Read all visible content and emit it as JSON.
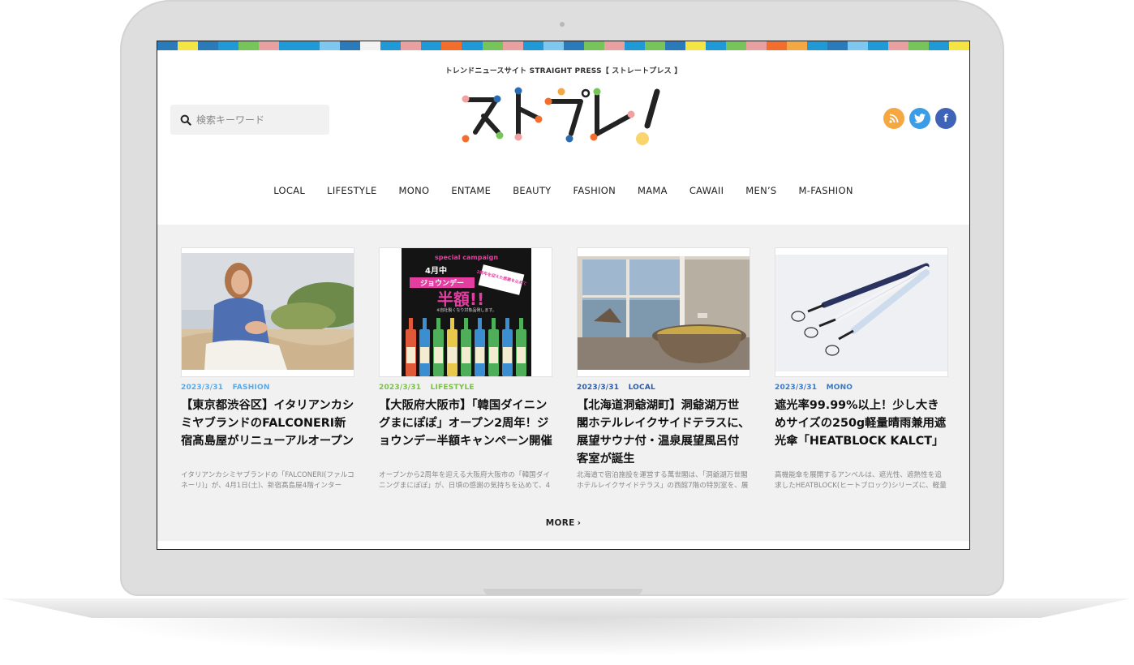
{
  "site": {
    "tagline": "トレンドニュースサイト STRAIGHT PRESS【 ストレートプレス 】",
    "logo_text": "ストプレ!",
    "colorbar": [
      "#2b7bba",
      "#f4e542",
      "#2b7bba",
      "#1f9ad6",
      "#76c45a",
      "#e9a0a0",
      "#1f9ad6",
      "#1f9ad6",
      "#7ec8ef",
      "#2b7bba",
      "#f2f2f2",
      "#1f9ad6",
      "#e9a0a0",
      "#1f9ad6",
      "#f36d2c",
      "#1f9ad6",
      "#76c45a",
      "#e9a0a0",
      "#1f9ad6",
      "#7ec8ef",
      "#2b7bba",
      "#76c45a",
      "#e9a0a0",
      "#1f9ad6",
      "#76c45a",
      "#2b7bba",
      "#f4e542",
      "#1f9ad6",
      "#76c45a",
      "#e9a0a0",
      "#f36d2c",
      "#f4a742",
      "#1f9ad6",
      "#2b7bba",
      "#7ec8ef",
      "#1f9ad6",
      "#e9a0a0",
      "#76c45a",
      "#1f9ad6",
      "#f4e542"
    ]
  },
  "search": {
    "placeholder": "検索キーワード"
  },
  "social": {
    "rss_label": "RSS",
    "twitter_label": "t",
    "facebook_label": "f"
  },
  "nav": {
    "items": [
      "LOCAL",
      "LIFESTYLE",
      "MONO",
      "ENTAME",
      "BEAUTY",
      "FASHION",
      "MAMA",
      "CAWAII",
      "MEN’S",
      "M-FASHION"
    ]
  },
  "articles": [
    {
      "date": "2023/3/31",
      "category": "FASHION",
      "category_color": "#5aa9e6",
      "title": "【東京都渋谷区】イタリアンカシミヤブランドのFALCONERI新宿髙島屋がリニューアルオープン",
      "excerpt": "イタリアンカシミヤブランドの「FALCONERI(ファルコネーリ)」が、4月1日(土)、新宿髙島屋4階インター"
    },
    {
      "date": "2023/3/31",
      "category": "LIFESTYLE",
      "category_color": "#7cbf4a",
      "title": "【大阪府大阪市】「韓国ダイニングまにぽぽ」オープン2周年！ジョウンデー半額キャンペーン開催",
      "excerpt": "オープンから2周年を迎える大阪府大阪市の「韓国ダイニングまにぽぽ」が、日頃の感謝の気持ちを込めて、4",
      "image_text": {
        "campaign": "special campaign",
        "month": "4月中",
        "event": "ジョウンデー",
        "half": "半額!!",
        "badge": "2周年を迎えた感謝を込めて",
        "note": "※自社製くなり対象品例します。"
      }
    },
    {
      "date": "2023/3/31",
      "category": "LOCAL",
      "category_color": "#2a5aa8",
      "title": "【北海道洞爺湖町】洞爺湖万世閣ホテルレイクサイドテラスに、展望サウナ付・温泉展望風呂付客室が誕生",
      "excerpt": "北海道で宿泊施設を運営する萬世閣は、「洞爺湖万世閣ホテルレイクサイドテラス」の西館7階の特別室を、展"
    },
    {
      "date": "2023/3/31",
      "category": "MONO",
      "category_color": "#3a78c2",
      "title": "遮光率99.99%以上！少し大きめサイズの250g軽量晴雨兼用遮光傘「HEATBLOCK KALCT」",
      "excerpt": "高機能傘を展開するアンベルは、遮光性、遮熱性を追求したHEATBLOCK(ヒートブロック)シリーズに、軽量長"
    }
  ],
  "more": {
    "label": "MORE"
  }
}
